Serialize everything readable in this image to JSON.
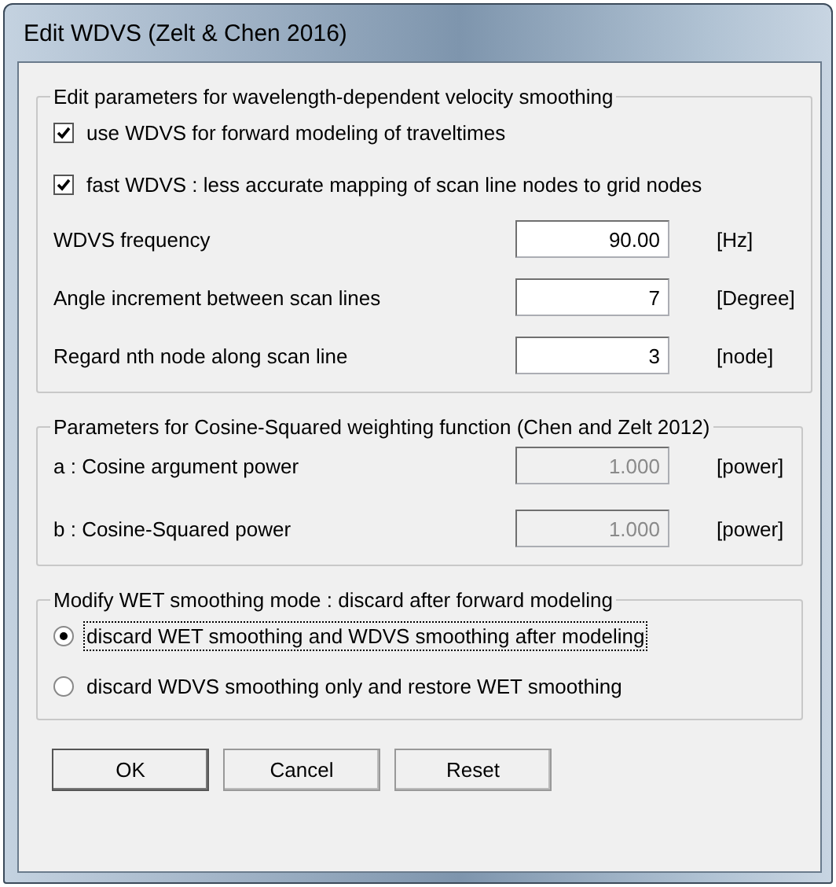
{
  "window": {
    "title": "Edit WDVS (Zelt & Chen 2016)"
  },
  "wdvs_group": {
    "title": "Edit parameters for wavelength-dependent velocity smoothing",
    "checkboxes": [
      {
        "label": "use WDVS for forward modeling of traveltimes",
        "checked": true
      },
      {
        "label": "fast WDVS : less accurate mapping of scan line nodes to grid nodes",
        "checked": true
      }
    ],
    "fields": [
      {
        "label": "WDVS frequency",
        "value": "90.00",
        "unit": "[Hz]",
        "disabled": false
      },
      {
        "label": "Angle increment between scan lines",
        "value": "7",
        "unit": "[Degree]",
        "disabled": false
      },
      {
        "label": "Regard nth node along scan line",
        "value": "3",
        "unit": "[node]",
        "disabled": false
      }
    ]
  },
  "cosine_group": {
    "title": "Parameters for Cosine-Squared weighting function (Chen and Zelt 2012)",
    "fields": [
      {
        "label": "a : Cosine argument power",
        "value": "1.000",
        "unit": "[power]",
        "disabled": true
      },
      {
        "label": "b : Cosine-Squared power",
        "value": "1.000",
        "unit": "[power]",
        "disabled": true
      }
    ]
  },
  "mode_group": {
    "title": "Modify WET smoothing mode : discard after forward modeling",
    "options": [
      {
        "label": "discard WET smoothing and WDVS smoothing after modeling",
        "selected": true,
        "focused": true
      },
      {
        "label": "discard WDVS smoothing only and restore WET smoothing",
        "selected": false,
        "focused": false
      }
    ]
  },
  "buttons": [
    {
      "label": "OK",
      "default": true
    },
    {
      "label": "Cancel",
      "default": false
    },
    {
      "label": "Reset",
      "default": false
    }
  ]
}
